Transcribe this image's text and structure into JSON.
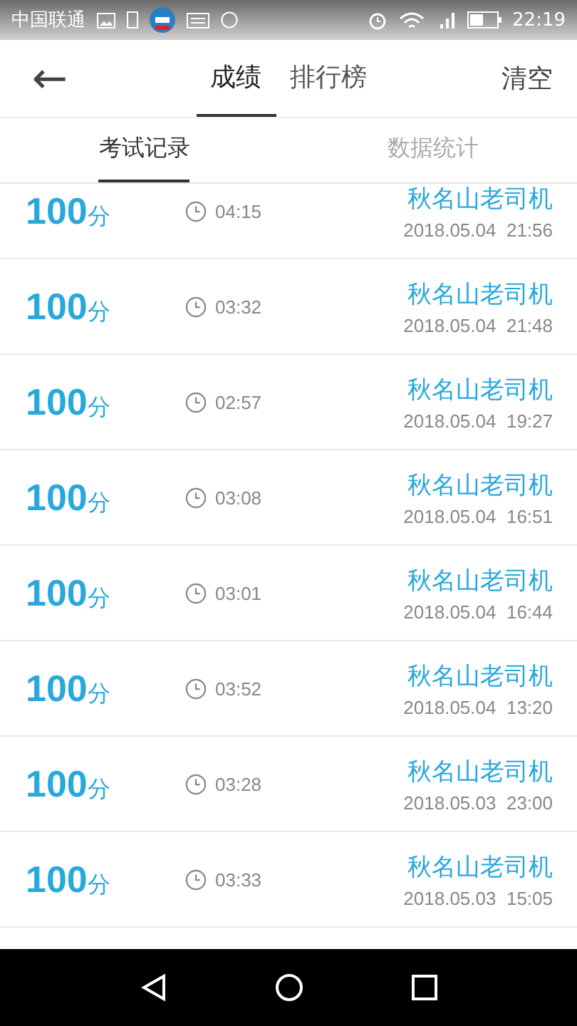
{
  "status_bar": {
    "carrier": "中国联通",
    "time": "22:19"
  },
  "header": {
    "back": "←",
    "tabs": [
      {
        "label": "成绩",
        "selected": true
      },
      {
        "label": "排行榜",
        "selected": false
      }
    ],
    "action": "清空"
  },
  "sub_tabs": [
    {
      "label": "考试记录",
      "selected": true
    },
    {
      "label": "数据统计",
      "selected": false
    }
  ],
  "records": [
    {
      "score": "100",
      "unit": "分",
      "duration": "04:15",
      "name": "秋名山老司机",
      "date": "2018.05.04",
      "time": "21:56"
    },
    {
      "score": "100",
      "unit": "分",
      "duration": "03:32",
      "name": "秋名山老司机",
      "date": "2018.05.04",
      "time": "21:48"
    },
    {
      "score": "100",
      "unit": "分",
      "duration": "02:57",
      "name": "秋名山老司机",
      "date": "2018.05.04",
      "time": "19:27"
    },
    {
      "score": "100",
      "unit": "分",
      "duration": "03:08",
      "name": "秋名山老司机",
      "date": "2018.05.04",
      "time": "16:51"
    },
    {
      "score": "100",
      "unit": "分",
      "duration": "03:01",
      "name": "秋名山老司机",
      "date": "2018.05.04",
      "time": "16:44"
    },
    {
      "score": "100",
      "unit": "分",
      "duration": "03:52",
      "name": "秋名山老司机",
      "date": "2018.05.04",
      "time": "13:20"
    },
    {
      "score": "100",
      "unit": "分",
      "duration": "03:28",
      "name": "秋名山老司机",
      "date": "2018.05.03",
      "time": "23:00"
    },
    {
      "score": "100",
      "unit": "分",
      "duration": "03:33",
      "name": "秋名山老司机",
      "date": "2018.05.03",
      "time": "15:05"
    }
  ]
}
